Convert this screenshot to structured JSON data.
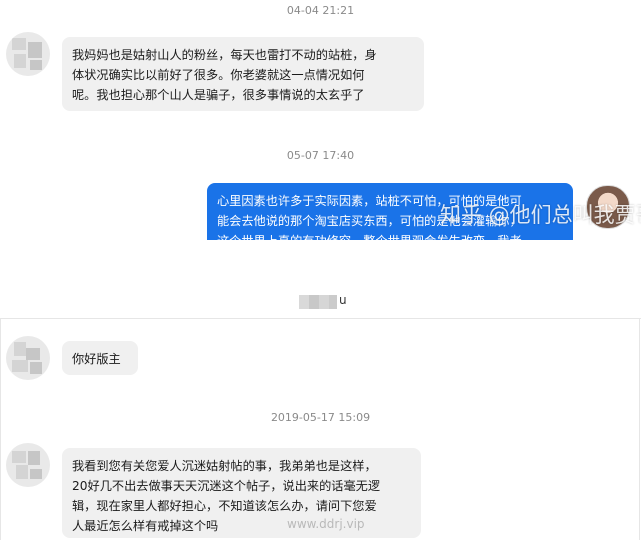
{
  "chat_top": {
    "timestamp_1": "04-04 21:21",
    "msg_1_lines": [
      "我妈妈也是姑射山人的粉丝，每天也雷打不动的站桩，身",
      "体状况确实比以前好了很多。你老婆就这一点情况如何",
      "呢。我也担心那个山人是骗子，很多事情说的太玄乎了"
    ],
    "timestamp_2": "05-07 17:40",
    "msg_2_lines": [
      "心里因素也许多于实际因素，站桩不可怕，可怕的是他可",
      "能会去他说的那个淘宝店买东西，可怕的是他会灌输你，",
      "这个世界上真的有功修穷，整个世界观会发生改变，我老"
    ],
    "watermark": "知乎 @他们总叫我贾哥"
  },
  "chat_bottom": {
    "contact_name": "u",
    "msg_1": "你好版主",
    "timestamp": "2019-05-17 15:09",
    "msg_2_lines": [
      "我看到您有关您爱人沉迷姑射帖的事，我弟弟也是这样，",
      "20好几不出去做事天天沉迷这个帖子，说出来的话毫无逻",
      "辑，现在家里人都好担心，不知道该怎么办，请问下您爱",
      "人最近怎么样有戒掉这个吗"
    ],
    "watermark": "www.ddrj.vip"
  },
  "colors": {
    "outgoing_bubble": "#1a73e8",
    "incoming_bubble": "#f0f0f0",
    "timestamp": "#8a8a8a"
  }
}
